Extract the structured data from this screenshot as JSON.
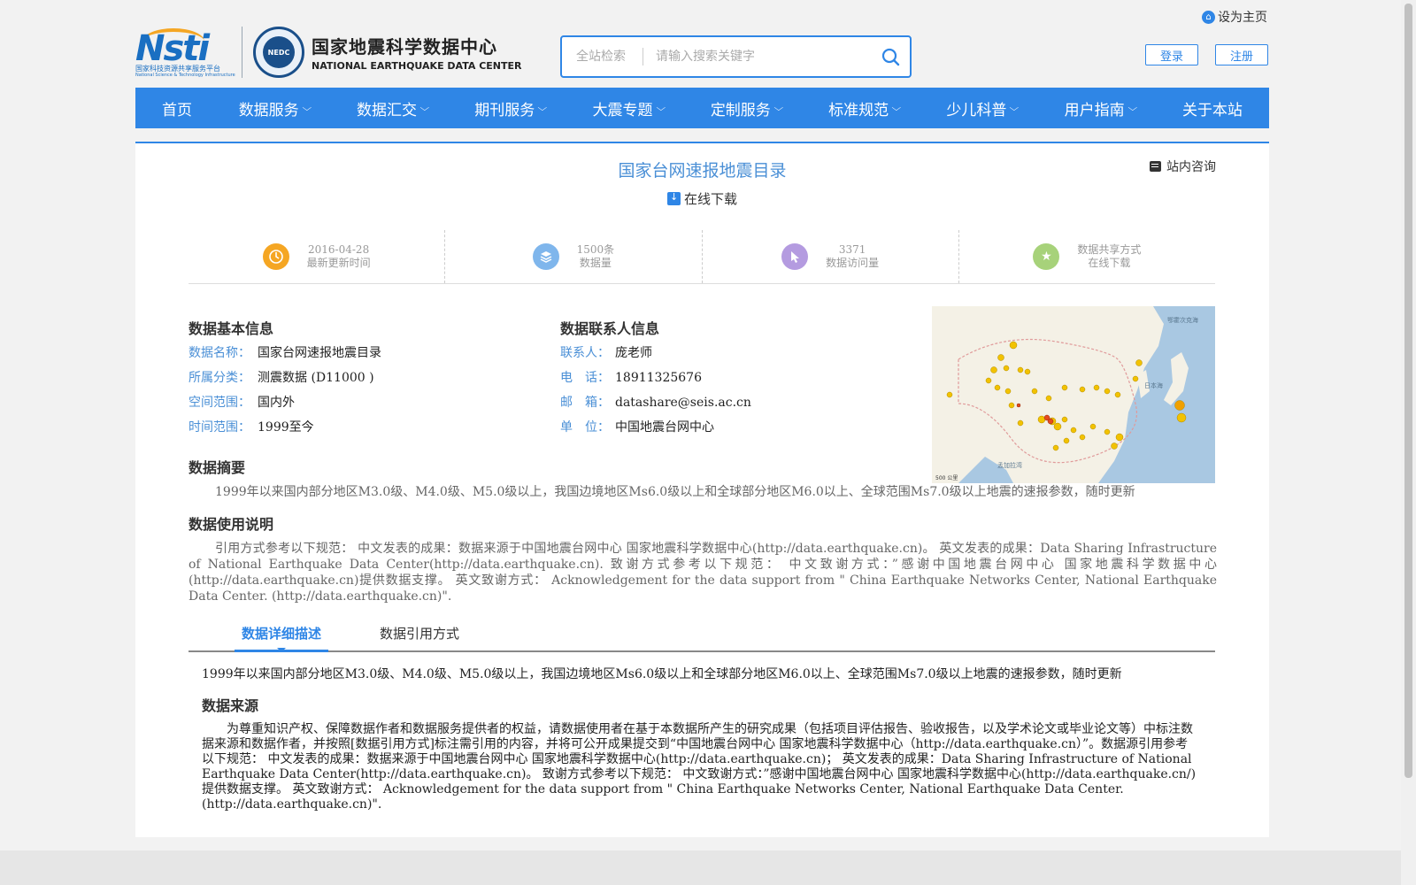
{
  "header": {
    "set_home": "设为主页",
    "logo_nsti": {
      "word": "Nsti",
      "sub_cn": "国家科技资源共享服务平台",
      "sub_en": "National Science & Technology Infrastructure"
    },
    "logo_nedc": {
      "emblem": "NEDC",
      "cn": "国家地震科学数据中心",
      "en": "NATIONAL EARTHQUAKE DATA CENTER"
    },
    "search": {
      "scope": "全站检索",
      "placeholder": "请输入搜索关键字"
    },
    "login": "登录",
    "register": "注册"
  },
  "nav": {
    "items": [
      {
        "label": "首页",
        "dropdown": false
      },
      {
        "label": "数据服务",
        "dropdown": true
      },
      {
        "label": "数据汇交",
        "dropdown": true
      },
      {
        "label": "期刊服务",
        "dropdown": true
      },
      {
        "label": "大震专题",
        "dropdown": true
      },
      {
        "label": "定制服务",
        "dropdown": true
      },
      {
        "label": "标准规范",
        "dropdown": true
      },
      {
        "label": "少儿科普",
        "dropdown": true
      },
      {
        "label": "用户指南",
        "dropdown": true
      },
      {
        "label": "关于本站",
        "dropdown": false
      }
    ]
  },
  "dataset": {
    "title": "国家台网速报地震目录",
    "consult": "站内咨询",
    "download": "在线下载"
  },
  "stats": [
    {
      "value": "2016-04-28",
      "label": "最新更新时间",
      "icon": "clock-icon",
      "color": "#f5a623"
    },
    {
      "value": "1500条",
      "label": "数据量",
      "icon": "layers-icon",
      "color": "#7fb6ec"
    },
    {
      "value": "3371",
      "label": "数据访问量",
      "icon": "cursor-icon",
      "color": "#b49be0"
    },
    {
      "value": "数据共享方式",
      "label": "在线下载",
      "icon": "star-icon",
      "color": "#a7d27a"
    }
  ],
  "basic_info": {
    "heading": "数据基本信息",
    "rows": [
      {
        "k": "数据名称：",
        "v": "国家台网速报地震目录"
      },
      {
        "k": "所属分类：",
        "v": "测震数据 (D11000 )"
      },
      {
        "k": "空间范围：",
        "v": "国内外"
      },
      {
        "k": "时间范围：",
        "v": "1999至今"
      }
    ]
  },
  "contact_info": {
    "heading": "数据联系人信息",
    "rows": [
      {
        "k": "联系人：",
        "v": "庞老师"
      },
      {
        "k": "电　话：",
        "v": "18911325676"
      },
      {
        "k": "邮　箱：",
        "v": "datashare@seis.ac.cn"
      },
      {
        "k": "单　位：",
        "v": "中国地震台网中心"
      }
    ]
  },
  "map_labels": {
    "ocean_ne": "鄂霍次克海",
    "sea_japan": "日本海",
    "bay_bengal": "孟加拉湾",
    "scale": "500 公里"
  },
  "abstract": {
    "heading": "数据摘要",
    "text": "1999年以来国内部分地区M3.0级、M4.0级、M5.0级以上，我国边境地区Ms6.0级以上和全球部分地区M6.0以上、全球范围Ms7.0级以上地震的速报参数，随时更新"
  },
  "usage": {
    "heading": "数据使用说明",
    "text": "引用方式参考以下规范：  中文发表的成果：数据来源于中国地震台网中心 国家地震科学数据中心(http://data.earthquake.cn)。  英文发表的成果：Data Sharing Infrastructure of National Earthquake Data Center(http://data.earthquake.cn). 致谢方式参考以下规范：  中文致谢方式：”感谢中国地震台网中心 国家地震科学数据中心(http://data.earthquake.cn)提供数据支撑。 英文致谢方式：  Acknowledgement for the data support from \" China Earthquake Networks Center, National Earthquake Data Center. (http://data.earthquake.cn)\"."
  },
  "tabs": {
    "active": "数据详细描述",
    "inactive": "数据引用方式"
  },
  "detail": {
    "desc": "1999年以来国内部分地区M3.0级、M4.0级、M5.0级以上，我国边境地区Ms6.0级以上和全球部分地区M6.0以上、全球范围Ms7.0级以上地震的速报参数，随时更新",
    "source_heading": "数据来源",
    "source_text": "为尊重知识产权、保障数据作者和数据服务提供者的权益，请数据使用者在基于本数据所产生的研究成果（包括项目评估报告、验收报告，以及学术论文或毕业论文等）中标注数据来源和数据作者，并按照[数据引用方式]标注需引用的内容，并将可公开成果提交到“中国地震台网中心 国家地震科学数据中心（http://data.earthquake.cn）”。数据源引用参考以下规范：  中文发表的成果：数据来源于中国地震台网中心 国家地震科学数据中心(http://data.earthquake.cn)；  英文发表的成果：Data Sharing Infrastructure of National Earthquake Data Center(http://data.earthquake.cn)。 致谢方式参考以下规范：  中文致谢方式：”感谢中国地震台网中心 国家地震科学数据中心(http://data.earthquake.cn/)提供数据支撑。 英文致谢方式：  Acknowledgement for the data support from \" China Earthquake Networks Center, National Earthquake Data Center. (http://data.earthquake.cn)\"."
  },
  "colors": {
    "accent": "#2f86e6",
    "label_blue": "#4a8fd6"
  }
}
